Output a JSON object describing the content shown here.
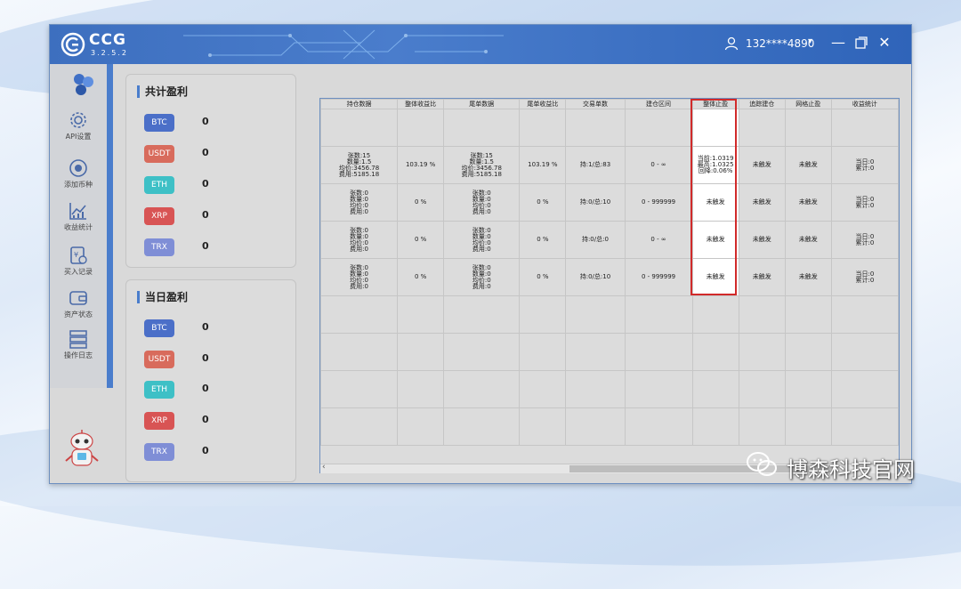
{
  "app": {
    "name": "CCG",
    "version": "3.2.5.2"
  },
  "user": {
    "account": "132****4890"
  },
  "sidebar": {
    "items": [
      {
        "label": "API设置",
        "icon": "gear-icon"
      },
      {
        "label": "添加币种",
        "icon": "add-coin-icon"
      },
      {
        "label": "收益统计",
        "icon": "chart-icon"
      },
      {
        "label": "买入记录",
        "icon": "record-icon"
      },
      {
        "label": "资产状态",
        "icon": "wallet-icon"
      },
      {
        "label": "操作日志",
        "icon": "log-icon"
      }
    ]
  },
  "total_profit": {
    "title": "共计盈利",
    "coins": [
      {
        "name": "BTC",
        "value": "0",
        "color": "#4b6fc8"
      },
      {
        "name": "USDT",
        "value": "0",
        "color": "#d86b5c"
      },
      {
        "name": "ETH",
        "value": "0",
        "color": "#3ec0c6"
      },
      {
        "name": "XRP",
        "value": "0",
        "color": "#d85454"
      },
      {
        "name": "TRX",
        "value": "0",
        "color": "#7f8ed6"
      }
    ]
  },
  "daily_profit": {
    "title": "当日盈利",
    "coins": [
      {
        "name": "BTC",
        "value": "0",
        "color": "#4b6fc8"
      },
      {
        "name": "USDT",
        "value": "0",
        "color": "#d86b5c"
      },
      {
        "name": "ETH",
        "value": "0",
        "color": "#3ec0c6"
      },
      {
        "name": "XRP",
        "value": "0",
        "color": "#d85454"
      },
      {
        "name": "TRX",
        "value": "0",
        "color": "#7f8ed6"
      }
    ]
  },
  "table": {
    "headers": [
      "持仓数据",
      "整体收益比",
      "尾单数据",
      "尾单收益比",
      "交易单数",
      "建仓区间",
      "整体止盈",
      "追踪建仓",
      "网格止盈",
      "收益统计"
    ],
    "rows": [
      [
        "",
        "",
        "",
        "",
        "",
        "",
        "",
        "",
        "",
        ""
      ],
      [
        "张数:15\n数量:1.5\n均价:3456.78\n费用:5185.18",
        "103.19 %",
        "张数:15\n数量:1.5\n均价:3456.78\n费用:5185.18",
        "103.19 %",
        "持:1/总:83",
        "0 - ∞",
        "当前:1.0319\n最高:1.0325\n回降:0.06%",
        "未触发",
        "未触发",
        "当日:0\n累计:0"
      ],
      [
        "张数:0\n数量:0\n均价:0\n费用:0",
        "0 %",
        "张数:0\n数量:0\n均价:0\n费用:0",
        "0 %",
        "持:0/总:10",
        "0 - 999999",
        "未触发",
        "未触发",
        "未触发",
        "当日:0\n累计:0"
      ],
      [
        "张数:0\n数量:0\n均价:0\n费用:0",
        "0 %",
        "张数:0\n数量:0\n均价:0\n费用:0",
        "0 %",
        "持:0/总:0",
        "0 - ∞",
        "未触发",
        "未触发",
        "未触发",
        "当日:0\n累计:0"
      ],
      [
        "张数:0\n数量:0\n均价:0\n费用:0",
        "0 %",
        "张数:0\n数量:0\n均价:0\n费用:0",
        "0 %",
        "持:0/总:10",
        "0 - 999999",
        "未触发",
        "未触发",
        "未触发",
        "当日:0\n累计:0"
      ],
      [
        "",
        "",
        "",
        "",
        "",
        "",
        "",
        "",
        "",
        ""
      ],
      [
        "",
        "",
        "",
        "",
        "",
        "",
        "",
        "",
        "",
        ""
      ],
      [
        "",
        "",
        "",
        "",
        "",
        "",
        "",
        "",
        "",
        ""
      ],
      [
        "",
        "",
        "",
        "",
        "",
        "",
        "",
        "",
        "",
        ""
      ]
    ]
  },
  "watermark": {
    "text": "博森科技官网"
  }
}
